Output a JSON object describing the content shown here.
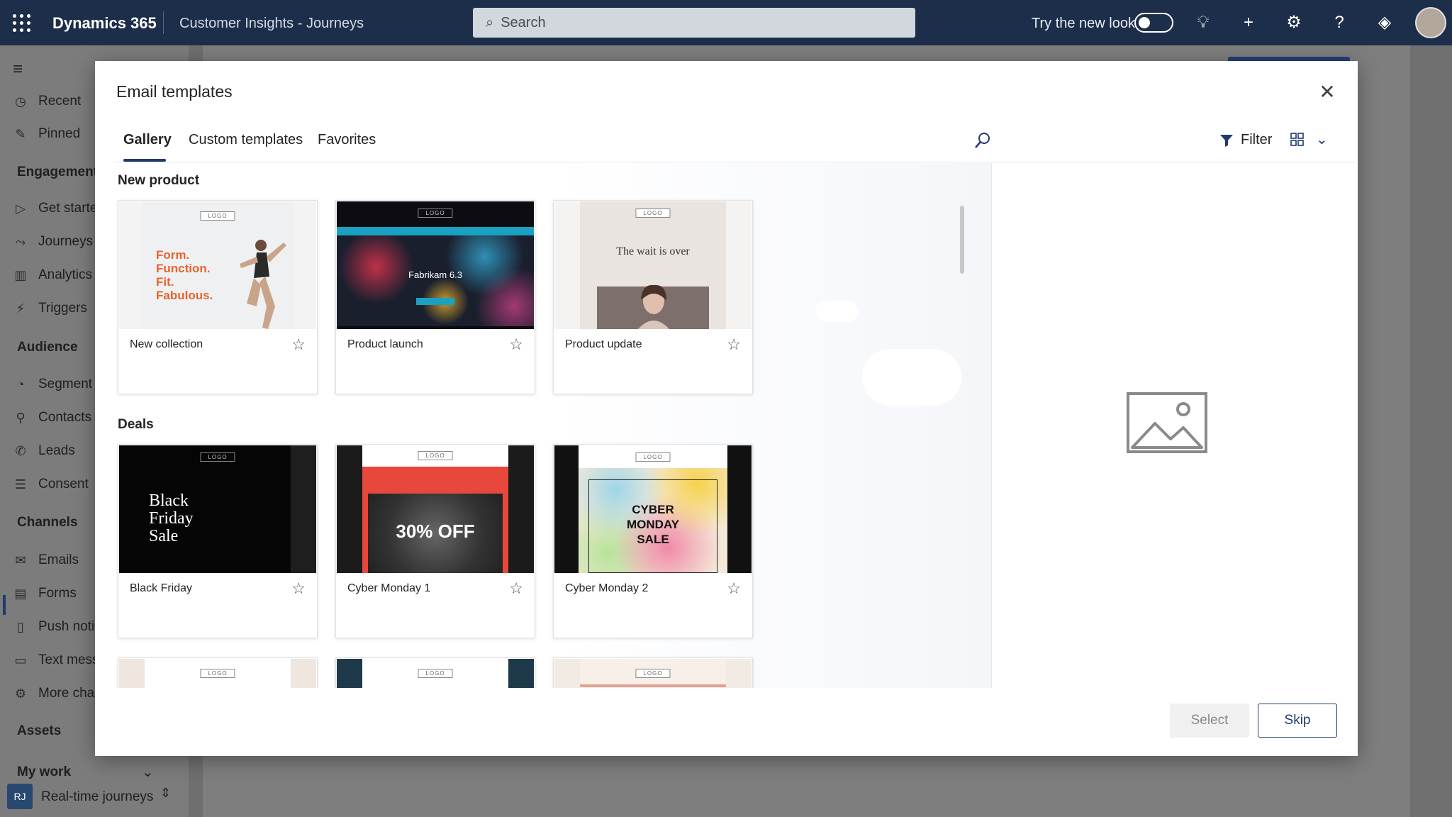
{
  "topbar": {
    "app_name": "Dynamics 365",
    "app_area": "Customer Insights - Journeys",
    "search_placeholder": "Search",
    "try_new_look": "Try the new look",
    "try_new_look_on": false
  },
  "nav": {
    "items": [
      {
        "label": "Recent",
        "icon": "clock-icon"
      },
      {
        "label": "Pinned",
        "icon": "pin-icon"
      },
      {
        "group": "Engagement"
      },
      {
        "label": "Get starte",
        "icon": "play-icon"
      },
      {
        "label": "Journeys",
        "icon": "journey-icon"
      },
      {
        "label": "Analytics",
        "icon": "analytics-icon"
      },
      {
        "label": "Triggers",
        "icon": "trigger-icon"
      },
      {
        "group": "Audience"
      },
      {
        "label": "Segment",
        "icon": "segment-icon"
      },
      {
        "label": "Contacts",
        "icon": "person-icon"
      },
      {
        "label": "Leads",
        "icon": "phone-icon"
      },
      {
        "label": "Consent",
        "icon": "consent-icon"
      },
      {
        "group": "Channels"
      },
      {
        "label": "Emails",
        "icon": "mail-icon",
        "selected": true
      },
      {
        "label": "Forms",
        "icon": "form-icon"
      },
      {
        "label": "Push noti",
        "icon": "device-icon"
      },
      {
        "label": "Text mess",
        "icon": "chat-icon"
      },
      {
        "label": "More cha",
        "icon": "gear-icon"
      },
      {
        "group": "Assets"
      },
      {
        "group": "My work"
      }
    ],
    "area_badge": "RJ",
    "area_label": "Real-time journeys"
  },
  "modal": {
    "title": "Email templates",
    "tabs": [
      "Gallery",
      "Custom templates",
      "Favorites"
    ],
    "active_tab": "Gallery",
    "filter_label": "Filter",
    "sections": [
      {
        "name": "New product",
        "cards": [
          {
            "name": "New collection",
            "thumb_text": "Form.\nFunction.\nFit.\nFabulous."
          },
          {
            "name": "Product launch",
            "thumb_text": "Fabrikam 6.3"
          },
          {
            "name": "Product update",
            "thumb_text": "The wait is over"
          }
        ]
      },
      {
        "name": "Deals",
        "cards": [
          {
            "name": "Black Friday",
            "thumb_text": "Black\nFriday\nSale"
          },
          {
            "name": "Cyber Monday 1",
            "thumb_text": "30% OFF"
          },
          {
            "name": "Cyber Monday 2",
            "thumb_text": "CYBER\nMONDAY\nSALE"
          }
        ]
      }
    ],
    "logo_text": "LOGO",
    "select_label": "Select",
    "skip_label": "Skip",
    "accent": "#1f3a6e"
  }
}
